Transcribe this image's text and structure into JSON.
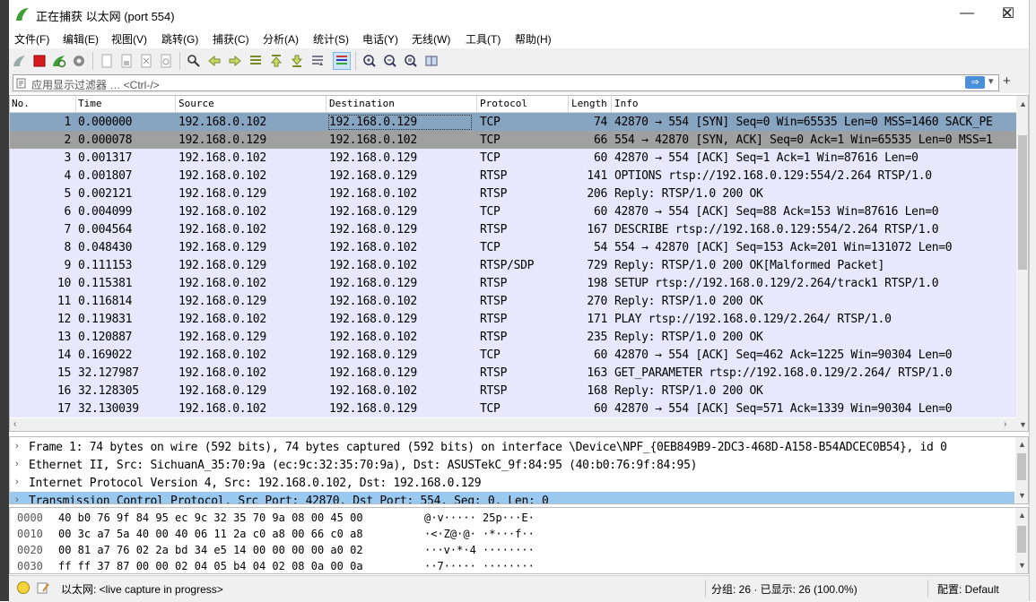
{
  "window": {
    "title": "正在捕获 以太网 (port 554)",
    "minimize_glyph": "—",
    "maximize_glyph": "☐",
    "close_glyph": "✕"
  },
  "menu": [
    "文件(F)",
    "编辑(E)",
    "视图(V)",
    "跳转(G)",
    "捕获(C)",
    "分析(A)",
    "统计(S)",
    "电话(Y)",
    "无线(W)",
    "工具(T)",
    "帮助(H)"
  ],
  "toolbar": {
    "icons": [
      "shark-fin-icon",
      "stop-capture-icon",
      "restart-capture-icon",
      "capture-options-icon",
      "open-file-icon",
      "save-file-icon",
      "close-file-icon",
      "reload-file-icon",
      "find-packet-icon",
      "go-back-icon",
      "go-forward-icon",
      "go-to-packet-icon",
      "go-first-icon",
      "go-last-icon",
      "auto-scroll-icon",
      "colorize-icon",
      "zoom-in-icon",
      "zoom-out-icon",
      "zoom-normal-icon",
      "resize-columns-icon"
    ]
  },
  "filter": {
    "placeholder": "应用显示过滤器 … <Ctrl-/>",
    "apply_glyph": "⇒",
    "dropdown_glyph": "▾",
    "add_glyph": "+"
  },
  "packet_list": {
    "columns": [
      "No.",
      "Time",
      "Source",
      "Destination",
      "Protocol",
      "Length",
      "Info"
    ],
    "rows": [
      {
        "no": "1",
        "time": "0.000000",
        "src": "192.168.0.102",
        "dst": "192.168.0.129",
        "proto": "TCP",
        "len": "74",
        "info": "42870 → 554 [SYN] Seq=0 Win=65535 Len=0 MSS=1460 SACK_PE"
      },
      {
        "no": "2",
        "time": "0.000078",
        "src": "192.168.0.129",
        "dst": "192.168.0.102",
        "proto": "TCP",
        "len": "66",
        "info": "554 → 42870 [SYN, ACK] Seq=0 Ack=1 Win=65535 Len=0 MSS=1"
      },
      {
        "no": "3",
        "time": "0.001317",
        "src": "192.168.0.102",
        "dst": "192.168.0.129",
        "proto": "TCP",
        "len": "60",
        "info": "42870 → 554 [ACK] Seq=1 Ack=1 Win=87616 Len=0"
      },
      {
        "no": "4",
        "time": "0.001807",
        "src": "192.168.0.102",
        "dst": "192.168.0.129",
        "proto": "RTSP",
        "len": "141",
        "info": "OPTIONS rtsp://192.168.0.129:554/2.264 RTSP/1.0"
      },
      {
        "no": "5",
        "time": "0.002121",
        "src": "192.168.0.129",
        "dst": "192.168.0.102",
        "proto": "RTSP",
        "len": "206",
        "info": "Reply: RTSP/1.0 200 OK"
      },
      {
        "no": "6",
        "time": "0.004099",
        "src": "192.168.0.102",
        "dst": "192.168.0.129",
        "proto": "TCP",
        "len": "60",
        "info": "42870 → 554 [ACK] Seq=88 Ack=153 Win=87616 Len=0"
      },
      {
        "no": "7",
        "time": "0.004564",
        "src": "192.168.0.102",
        "dst": "192.168.0.129",
        "proto": "RTSP",
        "len": "167",
        "info": "DESCRIBE rtsp://192.168.0.129:554/2.264 RTSP/1.0"
      },
      {
        "no": "8",
        "time": "0.048430",
        "src": "192.168.0.129",
        "dst": "192.168.0.102",
        "proto": "TCP",
        "len": "54",
        "info": "554 → 42870 [ACK] Seq=153 Ack=201 Win=131072 Len=0"
      },
      {
        "no": "9",
        "time": "0.111153",
        "src": "192.168.0.129",
        "dst": "192.168.0.102",
        "proto": "RTSP/SDP",
        "len": "729",
        "info": "Reply: RTSP/1.0 200 OK[Malformed Packet]"
      },
      {
        "no": "10",
        "time": "0.115381",
        "src": "192.168.0.102",
        "dst": "192.168.0.129",
        "proto": "RTSP",
        "len": "198",
        "info": "SETUP rtsp://192.168.0.129/2.264/track1 RTSP/1.0"
      },
      {
        "no": "11",
        "time": "0.116814",
        "src": "192.168.0.129",
        "dst": "192.168.0.102",
        "proto": "RTSP",
        "len": "270",
        "info": "Reply: RTSP/1.0 200 OK"
      },
      {
        "no": "12",
        "time": "0.119831",
        "src": "192.168.0.102",
        "dst": "192.168.0.129",
        "proto": "RTSP",
        "len": "171",
        "info": "PLAY rtsp://192.168.0.129/2.264/ RTSP/1.0"
      },
      {
        "no": "13",
        "time": "0.120887",
        "src": "192.168.0.129",
        "dst": "192.168.0.102",
        "proto": "RTSP",
        "len": "235",
        "info": "Reply: RTSP/1.0 200 OK"
      },
      {
        "no": "14",
        "time": "0.169022",
        "src": "192.168.0.102",
        "dst": "192.168.0.129",
        "proto": "TCP",
        "len": "60",
        "info": "42870 → 554 [ACK] Seq=462 Ack=1225 Win=90304 Len=0"
      },
      {
        "no": "15",
        "time": "32.127987",
        "src": "192.168.0.102",
        "dst": "192.168.0.129",
        "proto": "RTSP",
        "len": "163",
        "info": "GET_PARAMETER rtsp://192.168.0.129/2.264/ RTSP/1.0"
      },
      {
        "no": "16",
        "time": "32.128305",
        "src": "192.168.0.129",
        "dst": "192.168.0.102",
        "proto": "RTSP",
        "len": "168",
        "info": "Reply: RTSP/1.0 200 OK"
      },
      {
        "no": "17",
        "time": "32.130039",
        "src": "192.168.0.102",
        "dst": "192.168.0.129",
        "proto": "TCP",
        "len": "60",
        "info": "42870 → 554 [ACK] Seq=571 Ack=1339 Win=90304 Len=0"
      }
    ]
  },
  "details": [
    {
      "arrow": "›",
      "text": "Frame 1: 74 bytes on wire (592 bits), 74 bytes captured (592 bits) on interface \\Device\\NPF_{0EB849B9-2DC3-468D-A158-B54ADCEC0B54}, id 0"
    },
    {
      "arrow": "›",
      "text": "Ethernet II, Src: SichuanA_35:70:9a (ec:9c:32:35:70:9a), Dst: ASUSTekC_9f:84:95 (40:b0:76:9f:84:95)"
    },
    {
      "arrow": "›",
      "text": "Internet Protocol Version 4, Src: 192.168.0.102, Dst: 192.168.0.129"
    },
    {
      "arrow": "›",
      "text": "Transmission Control Protocol, Src Port: 42870, Dst Port: 554, Seq: 0, Len: 0"
    }
  ],
  "bytes": [
    {
      "off": "0000",
      "hex": "40 b0 76 9f 84 95 ec 9c  32 35 70 9a 08 00 45 00",
      "ascii": "@·v·····  25p···E·"
    },
    {
      "off": "0010",
      "hex": "00 3c a7 5a 40 00 40 06  11 2a c0 a8 00 66 c0 a8",
      "ascii": "·<·Z@·@·  ·*···f··"
    },
    {
      "off": "0020",
      "hex": "00 81 a7 76 02 2a bd 34  e5 14 00 00 00 00 a0 02",
      "ascii": "···v·*·4  ········"
    },
    {
      "off": "0030",
      "hex": "ff ff 37 87 00 00 02 04  05 b4 04 02 08 0a 00 0a",
      "ascii": "··7·····  ········"
    }
  ],
  "status": {
    "interface": "以太网: <live capture in progress>",
    "counts": "分组: 26 · 已显示: 26 (100.0%)",
    "profile": "配置: Default"
  },
  "colors": {
    "row_default": "#e8e8fc",
    "row_selected": "#87a4c1",
    "row_marked": "#a0a0a0",
    "detail_highlight": "#99c9ef",
    "shark_green": "#3d9e35",
    "stop_red": "#d7191c"
  }
}
